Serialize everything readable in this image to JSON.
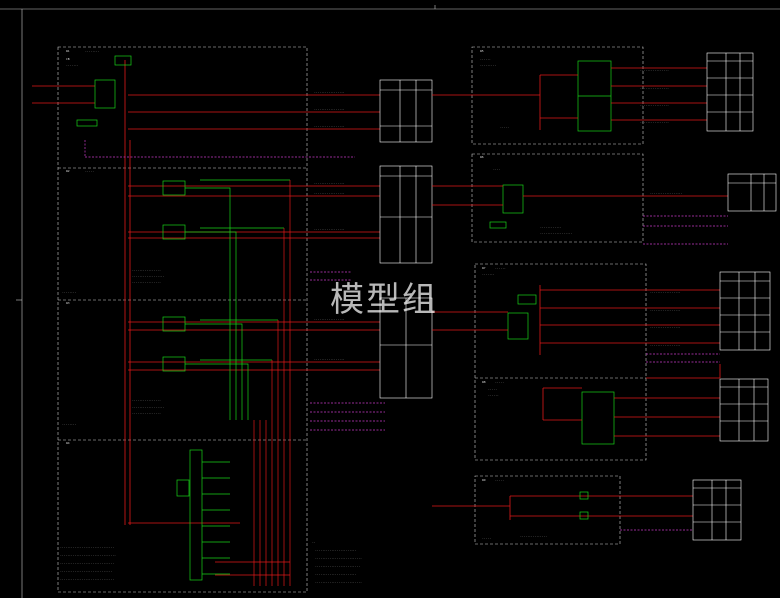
{
  "watermark": "模型组",
  "colors": {
    "background": "#000000",
    "frame": "#c8c8c8",
    "dashed": "#d0d0d0",
    "red_line": "#e01818",
    "green": "#19d219",
    "magenta": "#c83cc8",
    "white": "#ffffff",
    "yellow_green": "#b8d040"
  },
  "tables": {
    "upper_middle": {
      "header": [
        "",
        "",
        ""
      ],
      "rows": 3
    },
    "middle_block": {
      "header": [
        "",
        "",
        ""
      ],
      "rows": 4
    },
    "right_top": {
      "header": [
        "",
        "",
        ""
      ],
      "rows": 4
    },
    "right_second": {
      "header": [
        "",
        ""
      ],
      "rows": 2
    },
    "right_third": {
      "header": [
        "",
        "",
        ""
      ],
      "rows": 4
    },
    "right_fourth": {
      "header": [
        "",
        "",
        ""
      ],
      "rows": 4
    },
    "right_bottom": {
      "header": [
        "",
        "",
        ""
      ],
      "rows": 3
    }
  }
}
